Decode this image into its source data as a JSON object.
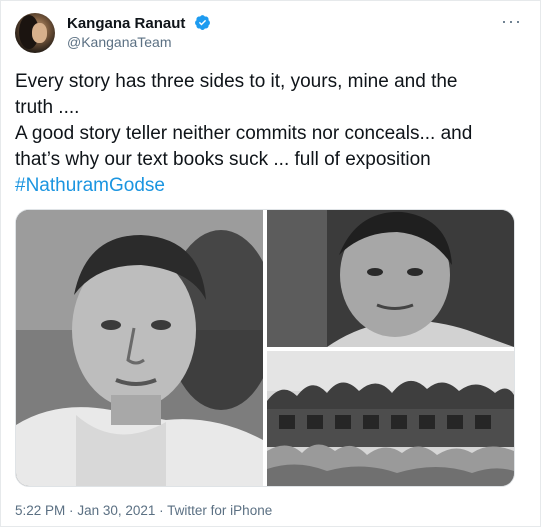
{
  "tweet": {
    "author_name": "Kangana Ranaut",
    "handle": "@KanganaTeam",
    "more_label": "···",
    "lines": [
      "Every story has three sides to it, yours, mine and the",
      "truth ....",
      "A good story teller neither commits nor conceals... and",
      "that’s why our text books suck ... full of exposition"
    ],
    "hashtag": "#NathuramGodse",
    "time": "5:22 PM",
    "date": "Jan 30, 2021",
    "separator": "·",
    "source": "Twitter for iPhone"
  },
  "colors": {
    "text": "#0f1419",
    "secondary": "#5b7083",
    "link": "#1b95e0",
    "verified": "#1d9bf0"
  },
  "icons": {
    "verified": "verified-badge-icon",
    "more": "more-options-icon"
  }
}
